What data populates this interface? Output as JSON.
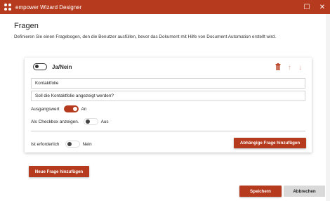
{
  "window": {
    "title": "empower Wizard Designer",
    "maximize_glyph": "☐",
    "close_glyph": "✕",
    "accent": "#b63a1d"
  },
  "page": {
    "title": "Fragen",
    "description": "Definieren Sie einen Fragebogen, den die Benutzer ausfüllen, bevor das Dokument mit Hilfe von Document Automation erstellt wird."
  },
  "question": {
    "type_label": "Ja/Nein",
    "icons": [
      "trash-icon",
      "arrow-up-icon",
      "arrow-down-icon"
    ],
    "trash_glyph": "🗑",
    "up_glyph": "↑",
    "down_glyph": "↓",
    "name_value": "Kontaktfolie",
    "question_value": "Soll die Kontaktfolie angezeigt werden?",
    "default_label": "Ausgangswert",
    "default_state": "An",
    "checkbox_label": "Als Checkbox anzeigen.",
    "checkbox_state": "Aus",
    "required_label": "Ist erforderlich",
    "required_state": "Nein",
    "dependent_button": "Abhängige Frage hinzufügen"
  },
  "actions": {
    "add_question": "Neue Frage hinzufügen",
    "save": "Speichern",
    "cancel": "Abbrechen"
  }
}
